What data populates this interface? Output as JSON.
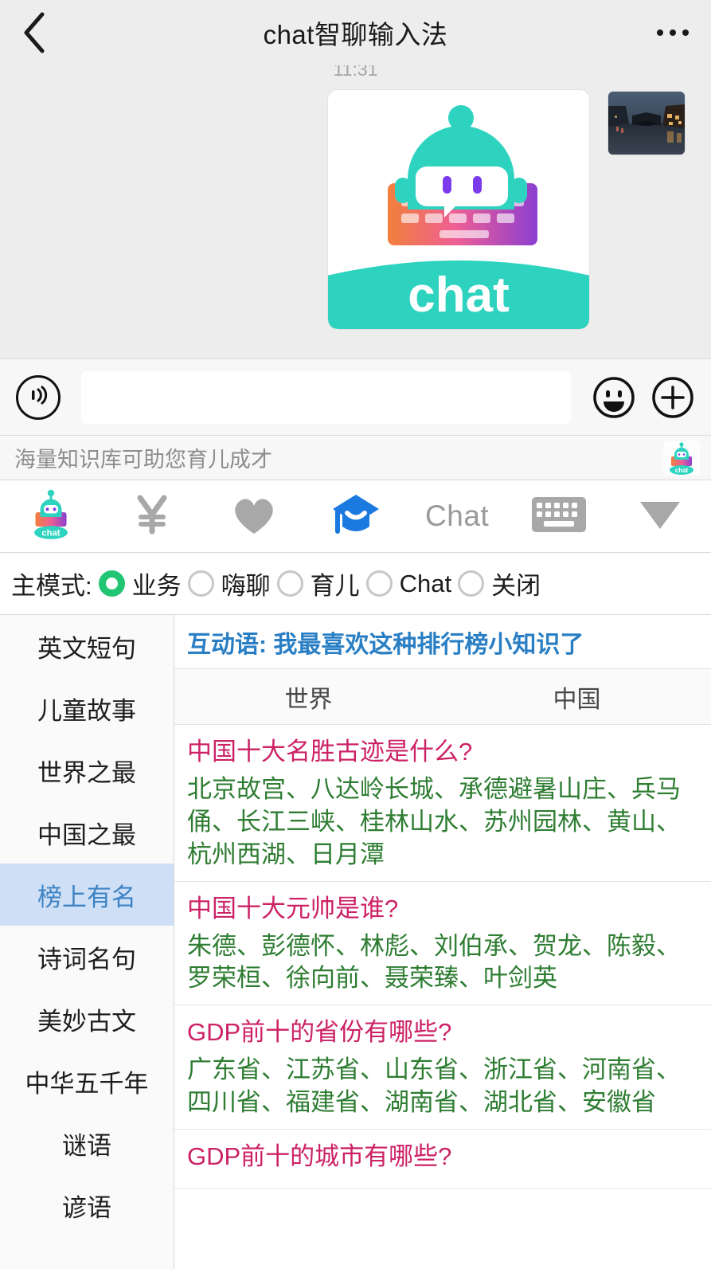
{
  "navbar": {
    "back_icon": "chevron-left-icon",
    "title": "chat智聊输入法",
    "more_icon": "more-options-icon"
  },
  "chat": {
    "timestamp": "11:31",
    "logo_word": "chat",
    "logo_colors": {
      "robot": "#2ed3c0",
      "keyboard_left": "#f2803c",
      "keyboard_mid": "#e8559b",
      "keyboard_right": "#8c3fd1",
      "band": "#2ed3c0",
      "eye": "#7c3aed"
    },
    "photo_alt": "canal-town-night-photo"
  },
  "input_bar": {
    "voice_icon": "voice-wave-icon",
    "input_value": "",
    "input_placeholder": "",
    "emoji_icon": "smiley-face-icon",
    "plus_icon": "plus-circle-icon"
  },
  "banner": {
    "text": "海量知识库可助您育儿成才",
    "logo_icon": "chat-app-logo-icon",
    "logo_word": "chat"
  },
  "icon_bar": {
    "items": [
      {
        "name": "chat-app-logo-icon",
        "label": "chat",
        "active": false
      },
      {
        "name": "yen-currency-icon",
        "label": "¥",
        "active": false
      },
      {
        "name": "heart-icon",
        "label": "",
        "active": false
      },
      {
        "name": "graduation-cap-icon",
        "label": "",
        "active": true
      },
      {
        "name": "chat-text-label",
        "label": "Chat",
        "active": false
      },
      {
        "name": "keyboard-icon",
        "label": "",
        "active": false
      },
      {
        "name": "chevron-down-icon",
        "label": "",
        "active": false
      }
    ],
    "accent_color": "#1a7ae0",
    "inactive_color": "#a8a8a8"
  },
  "mode_row": {
    "label": "主模式:",
    "selected": "业务",
    "accent_color": "#21c573",
    "options": [
      {
        "label": "业务",
        "selected": true
      },
      {
        "label": "嗨聊",
        "selected": false
      },
      {
        "label": "育儿",
        "selected": false
      },
      {
        "label": "Chat",
        "selected": false
      },
      {
        "label": "关闭",
        "selected": false
      }
    ]
  },
  "sidebar": {
    "selected": "榜上有名",
    "items": [
      {
        "label": "英文短句",
        "active": false
      },
      {
        "label": "儿童故事",
        "active": false
      },
      {
        "label": "世界之最",
        "active": false
      },
      {
        "label": "中国之最",
        "active": false
      },
      {
        "label": "榜上有名",
        "active": true
      },
      {
        "label": "诗词名句",
        "active": false
      },
      {
        "label": "美妙古文",
        "active": false
      },
      {
        "label": "中华五千年",
        "active": false
      },
      {
        "label": "谜语",
        "active": false
      },
      {
        "label": "谚语",
        "active": false
      }
    ]
  },
  "content": {
    "header": "互动语: 我最喜欢这种排行榜小知识了",
    "header_color": "#2a7fc4",
    "tabs": [
      {
        "label": "世界",
        "active": false
      },
      {
        "label": "中国",
        "active": false
      }
    ],
    "question_color": "#cc2266",
    "answer_color": "#2e7d32",
    "qa": [
      {
        "question": "中国十大名胜古迹是什么?",
        "answer": "北京故宫、八达岭长城、承德避暑山庄、兵马俑、长江三峡、桂林山水、苏州园林、黄山、杭州西湖、日月潭"
      },
      {
        "question": "中国十大元帅是谁?",
        "answer": "朱德、彭德怀、林彪、刘伯承、贺龙、陈毅、罗荣桓、徐向前、聂荣臻、叶剑英"
      },
      {
        "question": "GDP前十的省份有哪些?",
        "answer": "广东省、江苏省、山东省、浙江省、河南省、四川省、福建省、湖南省、湖北省、安徽省"
      },
      {
        "question": "GDP前十的城市有哪些?",
        "answer": ""
      }
    ]
  }
}
